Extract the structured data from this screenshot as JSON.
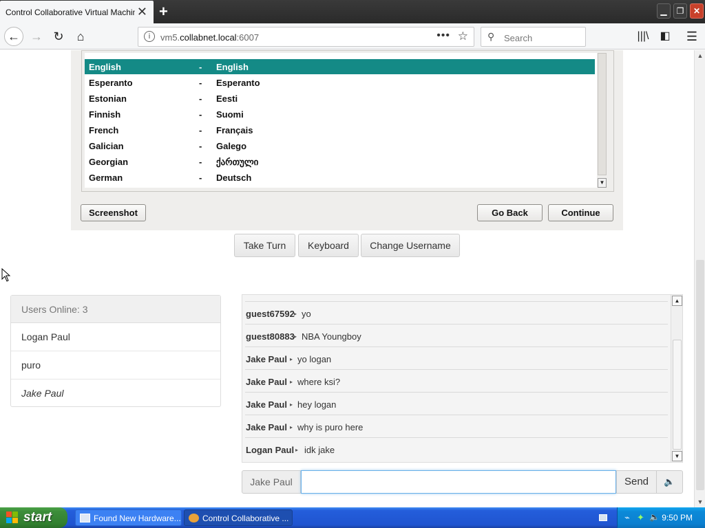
{
  "browser": {
    "tab_title": "Control Collaborative Virtual Machines!",
    "url_prefix": "vm5.",
    "url_host": "collabnet.local",
    "url_port": ":6007",
    "search_placeholder": "Search"
  },
  "language_list": {
    "rows": [
      {
        "name": "English",
        "sep": "-",
        "native": "English",
        "selected": true
      },
      {
        "name": "Esperanto",
        "sep": "-",
        "native": "Esperanto"
      },
      {
        "name": "Estonian",
        "sep": "-",
        "native": "Eesti"
      },
      {
        "name": "Finnish",
        "sep": "-",
        "native": "Suomi"
      },
      {
        "name": "French",
        "sep": "-",
        "native": "Français"
      },
      {
        "name": "Galician",
        "sep": "-",
        "native": "Galego"
      },
      {
        "name": "Georgian",
        "sep": "-",
        "native": "ქართული"
      },
      {
        "name": "German",
        "sep": "-",
        "native": "Deutsch"
      }
    ]
  },
  "installer_buttons": {
    "screenshot": "Screenshot",
    "go_back": "Go Back",
    "continue": "Continue"
  },
  "vm_controls": {
    "take_turn": "Take Turn",
    "keyboard": "Keyboard",
    "change_username": "Change Username"
  },
  "users": {
    "header": "Users Online: 3",
    "list": [
      "Logan Paul",
      "puro",
      "Jake Paul"
    ]
  },
  "chat": {
    "messages": [
      {
        "user": "guest67592",
        "text": "yo"
      },
      {
        "user": "guest80883",
        "text": "NBA Youngboy"
      },
      {
        "user": "Jake Paul",
        "text": "yo logan"
      },
      {
        "user": "Jake Paul",
        "text": "where ksi?"
      },
      {
        "user": "Jake Paul",
        "text": "hey logan"
      },
      {
        "user": "Jake Paul",
        "text": "why is puro here"
      },
      {
        "user": "Logan Paul",
        "text": "idk jake"
      }
    ],
    "username_label": "Jake Paul",
    "input_value": "",
    "send_label": "Send"
  },
  "taskbar": {
    "start_label": "start",
    "items": [
      "Found New Hardware...",
      "Control Collaborative ..."
    ],
    "clock": "9:50 PM"
  }
}
